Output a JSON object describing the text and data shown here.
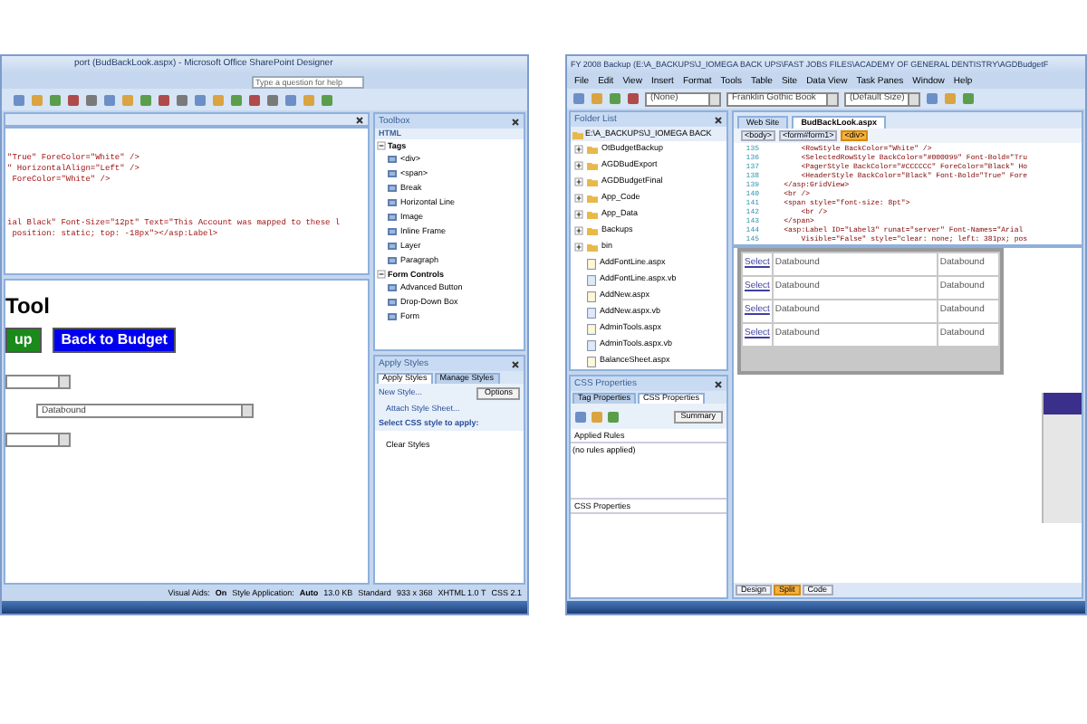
{
  "left_window": {
    "title": "port (BudBackLook.aspx) - Microsoft Office SharePoint Designer",
    "help": {
      "placeholder": "Type a question for help"
    },
    "code_blocks": [
      [
        "\"True\" ForeColor=\"White\" />",
        "\" HorizontalAlign=\"Left\" />",
        " ForeColor=\"White\" />"
      ],
      [
        "ial Black\" Font-Size=\"12pt\" Text=\"This Account was mapped to these l",
        " position: static; top: -18px\"></asp:Label>"
      ]
    ],
    "design": {
      "heading": "Tool",
      "buttons": [
        {
          "label": "up",
          "color": "#1a8a1a"
        },
        {
          "label": "Back to Budget",
          "color": "#0000ee"
        }
      ],
      "dropdowns": [
        {
          "kind": "short"
        },
        {
          "kind": "wide",
          "value": "Databound"
        },
        {
          "kind": "short"
        }
      ]
    },
    "toolbox": {
      "title": "Toolbox",
      "header": "HTML",
      "groups": [
        {
          "label": "Tags",
          "expanded": true,
          "items": [
            "<div>",
            "<span>",
            "Break",
            "Horizontal Line",
            "Image",
            "Inline Frame",
            "Layer",
            "Paragraph"
          ]
        },
        {
          "label": "Form Controls",
          "expanded": true,
          "items": [
            "Advanced Button",
            "Drop-Down Box",
            "Form"
          ]
        }
      ]
    },
    "apply_styles": {
      "title": "Apply Styles",
      "tabs": [
        {
          "label": "Apply Styles",
          "selected": true
        },
        {
          "label": "Manage Styles",
          "selected": false
        }
      ],
      "new_style": "New Style...",
      "options": "Options",
      "attach": "Attach Style Sheet...",
      "prompt": "Select CSS style to apply:",
      "styles": [
        "Clear Styles"
      ]
    },
    "status_bar": [
      {
        "text": "Visual Aids:",
        "kind": "label"
      },
      {
        "text": "On",
        "kind": "value"
      },
      {
        "text": "Style Application:",
        "kind": "label"
      },
      {
        "text": "Auto",
        "kind": "value"
      },
      {
        "text": "13.0 KB",
        "kind": "label"
      },
      {
        "text": "Standard",
        "kind": "label"
      },
      {
        "text": "933 x 368",
        "kind": "label"
      },
      {
        "text": "XHTML 1.0 T",
        "kind": "label"
      },
      {
        "text": "CSS 2.1",
        "kind": "label"
      }
    ]
  },
  "right_window": {
    "title": "FY 2008 Backup (E:\\A_BACKUPS\\J_IOMEGA BACK UPS\\FAST JOBS FILES\\ACADEMY OF GENERAL DENTISTRY\\AGDBudgetF",
    "menu": [
      "File",
      "Edit",
      "View",
      "Insert",
      "Format",
      "Tools",
      "Table",
      "Site",
      "Data View",
      "Task Panes",
      "Window",
      "Help"
    ],
    "toolbar_dropdowns": [
      "(None)",
      "Franklin Gothic Book",
      "(Default Size)"
    ],
    "folder_list": {
      "title": "Folder List",
      "root": "E:\\A_BACKUPS\\J_IOMEGA BACK",
      "items": [
        {
          "label": "OtBudgetBackup",
          "kind": "folder"
        },
        {
          "label": "AGDBudExport",
          "kind": "folder"
        },
        {
          "label": "AGDBudgetFinal",
          "kind": "folder"
        },
        {
          "label": "App_Code",
          "kind": "folder"
        },
        {
          "label": "App_Data",
          "kind": "folder"
        },
        {
          "label": "Backups",
          "kind": "folder"
        },
        {
          "label": "bin",
          "kind": "folder"
        },
        {
          "label": "AddFontLine.aspx",
          "kind": "page"
        },
        {
          "label": "AddFontLine.aspx.vb",
          "kind": "code"
        },
        {
          "label": "AddNew.aspx",
          "kind": "page"
        },
        {
          "label": "AddNew.aspx.vb",
          "kind": "code"
        },
        {
          "label": "AdminTools.aspx",
          "kind": "page"
        },
        {
          "label": "AdminTools.aspx.vb",
          "kind": "code"
        },
        {
          "label": "BalanceSheet.aspx",
          "kind": "page"
        }
      ]
    },
    "css_properties": {
      "title": "CSS Properties",
      "tabs": [
        {
          "label": "Tag Properties",
          "selected": false
        },
        {
          "label": "CSS Properties",
          "selected": true
        }
      ],
      "summary": "Summary",
      "applied_rules": "Applied Rules",
      "no_rules": "(no rules applied)",
      "properties": "CSS Properties"
    },
    "editor_tabs": [
      {
        "label": "Web Site",
        "selected": false
      },
      {
        "label": "BudBackLook.aspx",
        "selected": true
      }
    ],
    "breadcrumb": [
      {
        "label": "<body>",
        "selected": false
      },
      {
        "label": "<form#form1>",
        "selected": false
      },
      {
        "label": "<div>",
        "selected": true
      }
    ],
    "code_lines": [
      {
        "number": "135",
        "text": "        <RowStyle BackColor=\"White\" />"
      },
      {
        "number": "136",
        "text": "        <SelectedRowStyle BackColor=\"#000099\" Font-Bold=\"Tru"
      },
      {
        "number": "137",
        "text": "        <PagerStyle BackColor=\"#CCCCCC\" ForeColor=\"Black\" Ho"
      },
      {
        "number": "138",
        "text": "        <HeaderStyle BackColor=\"Black\" Font-Bold=\"True\" Fore"
      },
      {
        "number": "139",
        "text": "    </asp:GridView>"
      },
      {
        "number": "140",
        "text": "    <br />"
      },
      {
        "number": "141",
        "text": "    <span style=\"font-size: 8pt\">"
      },
      {
        "number": "142",
        "text": "        <br />"
      },
      {
        "number": "143",
        "text": "    </span>"
      },
      {
        "number": "144",
        "text": "    <asp:Label ID=\"Label3\" runat=\"server\" Font-Names=\"Arial"
      },
      {
        "number": "145",
        "text": "        Visible=\"False\" style=\"clear: none; left: 381px; pos"
      }
    ],
    "grid_rows": [
      {
        "link": "Select",
        "column_2": "Databound",
        "column_3": "Databound"
      },
      {
        "link": "Select",
        "column_2": "Databound",
        "column_3": "Databound"
      },
      {
        "link": "Select",
        "column_2": "Databound",
        "column_3": "Databound"
      },
      {
        "link": "Select",
        "column_2": "Databound",
        "column_3": "Databound"
      }
    ],
    "view_tabs": [
      {
        "label": "Design",
        "selected": false
      },
      {
        "label": "Split",
        "selected": true
      },
      {
        "label": "Code",
        "selected": false
      }
    ]
  }
}
